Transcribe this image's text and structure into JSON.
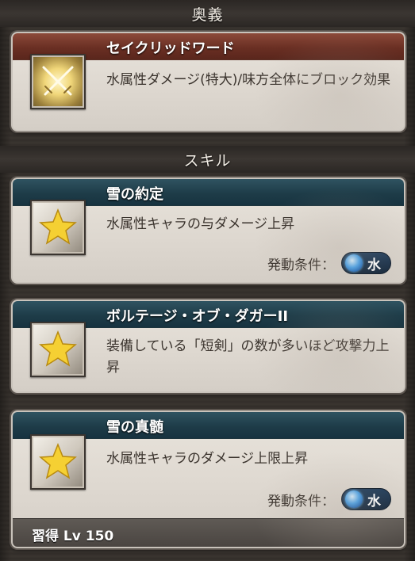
{
  "sections": {
    "ougi_header": "奥義",
    "skill_header": "スキル"
  },
  "ougi": {
    "title": "セイクリッドワード",
    "icon": "crossed-swords-icon",
    "description": "水属性ダメージ(特大)/味方全体にブロック効果"
  },
  "skills": [
    {
      "title": "雪の約定",
      "icon": "star-icon",
      "description": "水属性キャラの与ダメージ上昇",
      "condition_label": "発動条件：",
      "element": "水"
    },
    {
      "title": "ボルテージ・オブ・ダガーII",
      "icon": "star-icon",
      "description": "装備している「短剣」の数が多いほど攻撃力上昇"
    },
    {
      "title": "雪の真髄",
      "icon": "star-icon",
      "description": "水属性キャラのダメージ上限上昇",
      "condition_label": "発動条件：",
      "element": "水",
      "learn": "習得 Lv 150"
    }
  ],
  "colors": {
    "ougi_title_bar": "#6a2f23",
    "skill_title_bar": "#1e3c48",
    "water_pill": "#1e3b5a"
  }
}
